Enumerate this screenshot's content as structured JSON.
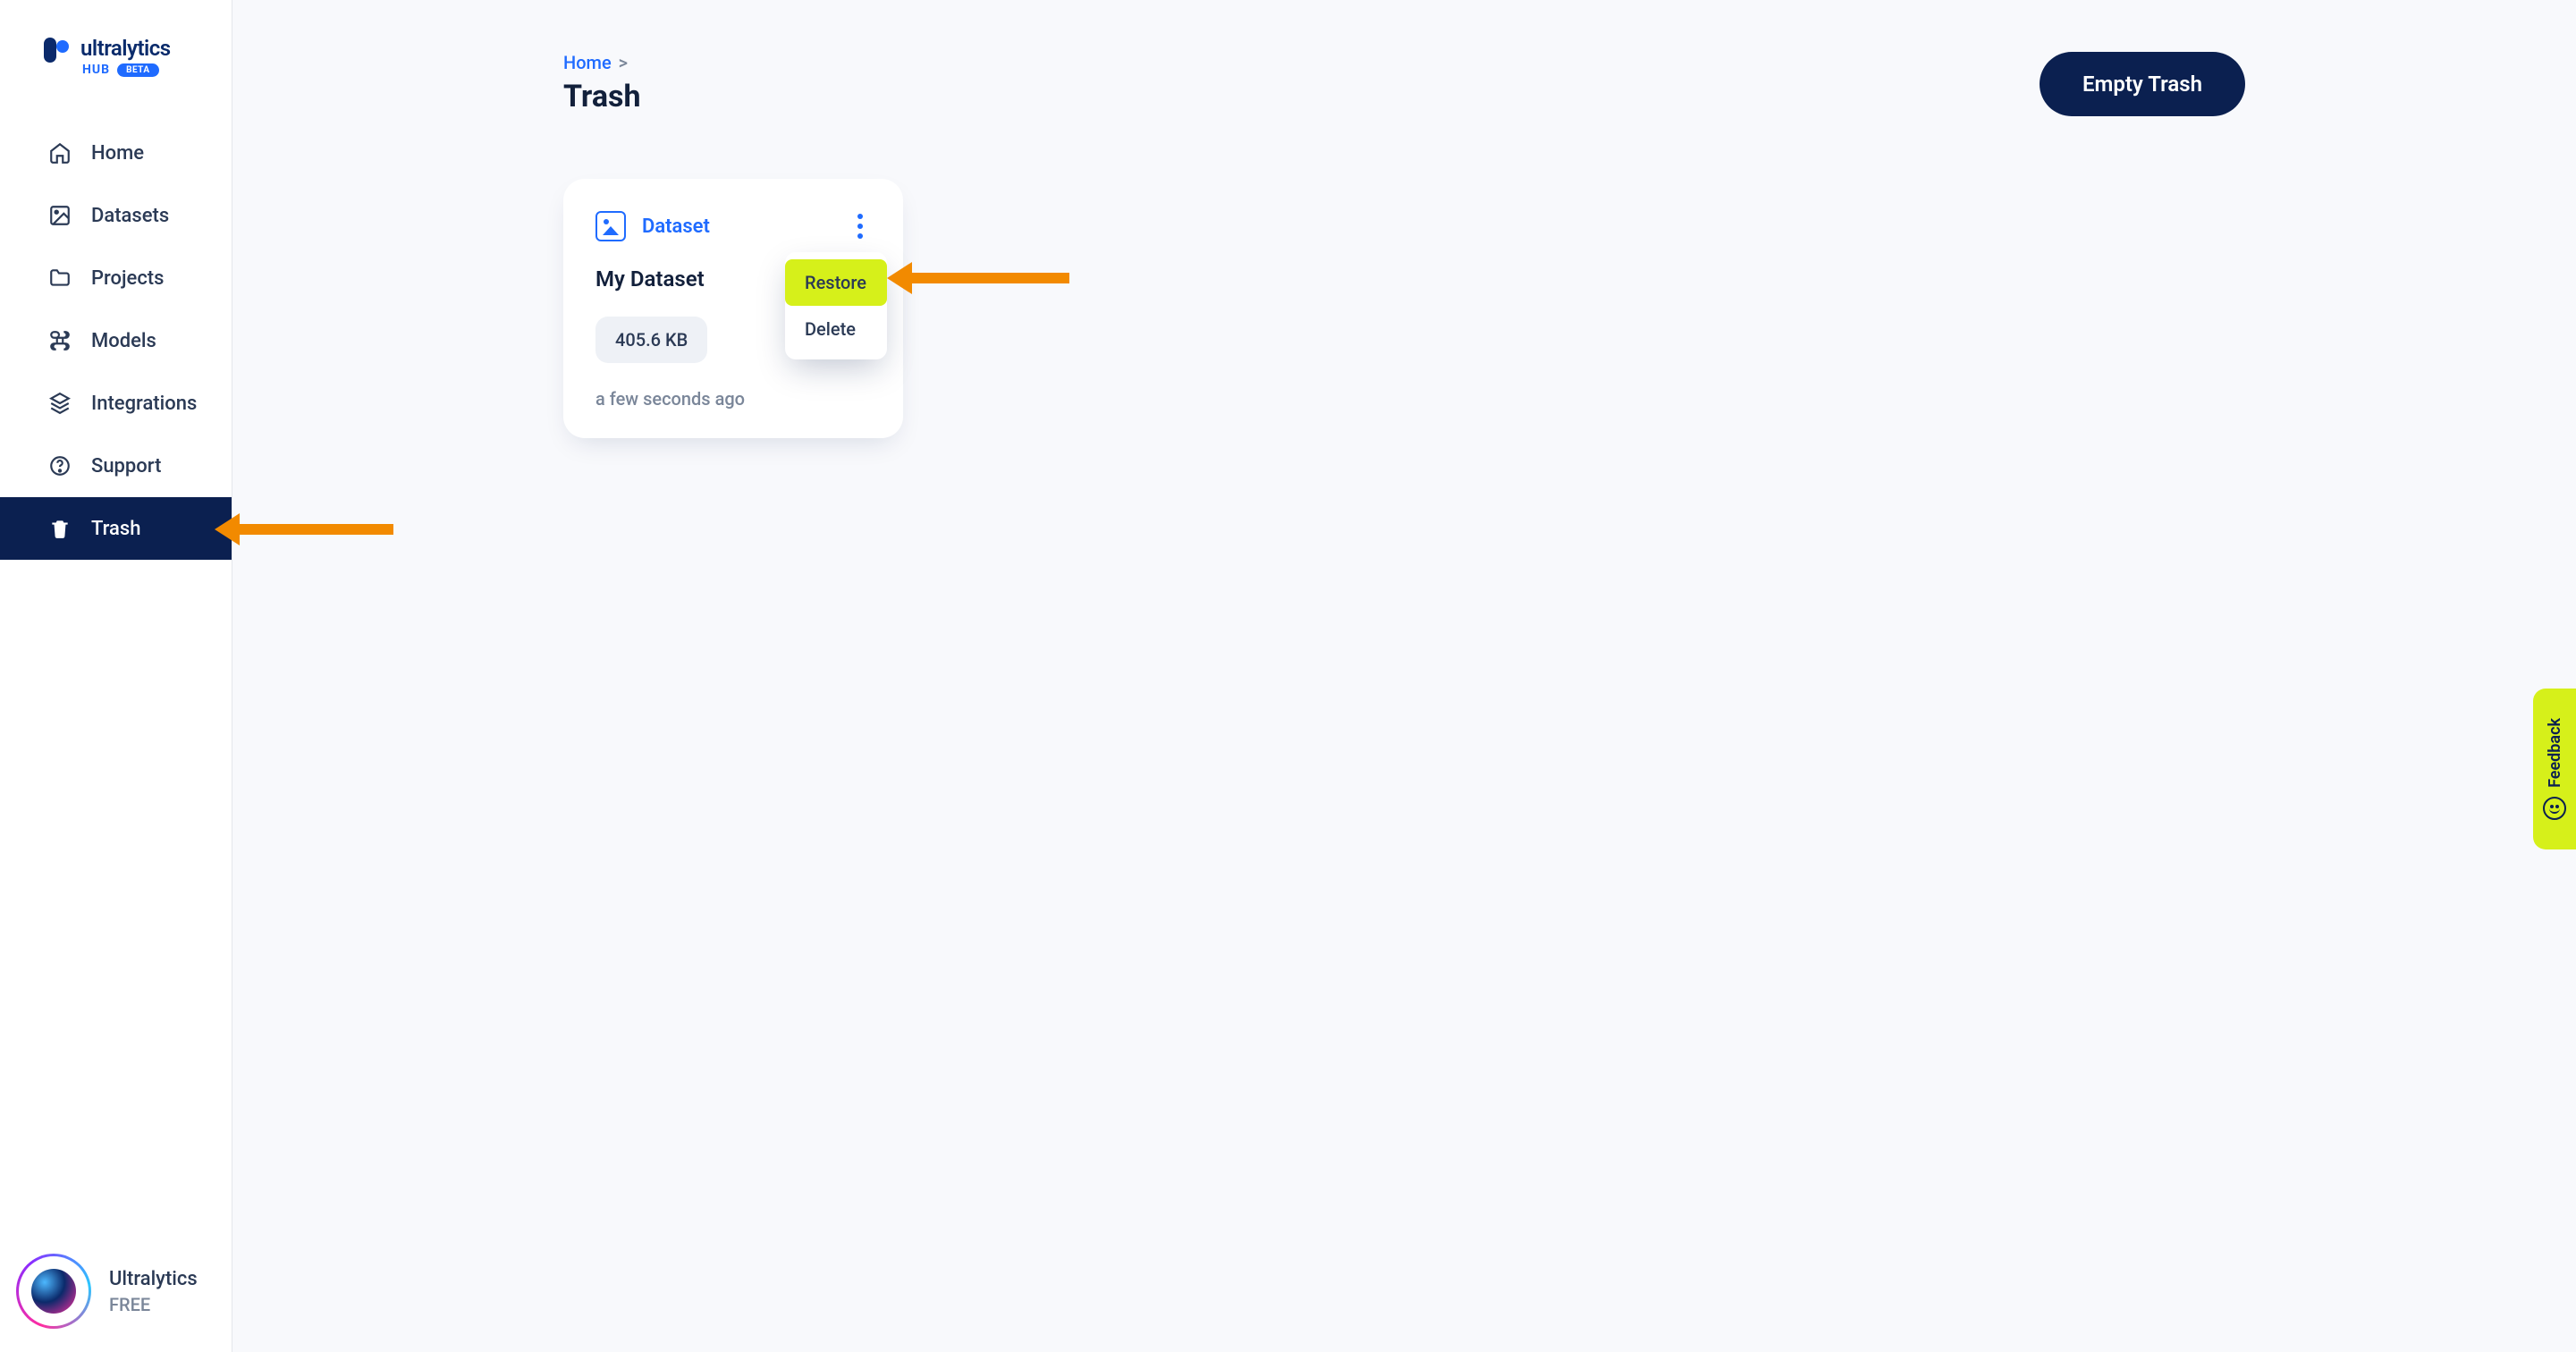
{
  "brand": {
    "name": "ultralytics",
    "sub": "HUB",
    "badge": "BETA"
  },
  "sidebar": {
    "items": [
      {
        "id": "home",
        "label": "Home"
      },
      {
        "id": "datasets",
        "label": "Datasets"
      },
      {
        "id": "projects",
        "label": "Projects"
      },
      {
        "id": "models",
        "label": "Models"
      },
      {
        "id": "integrations",
        "label": "Integrations"
      },
      {
        "id": "support",
        "label": "Support"
      },
      {
        "id": "trash",
        "label": "Trash"
      }
    ],
    "active": "trash"
  },
  "user": {
    "name": "Ultralytics",
    "plan": "FREE"
  },
  "breadcrumb": {
    "root": "Home",
    "sep": ">"
  },
  "page": {
    "title": "Trash"
  },
  "actions": {
    "empty_trash": "Empty Trash"
  },
  "card": {
    "type": "Dataset",
    "name": "My Dataset",
    "size": "405.6 KB",
    "time": "a few seconds ago"
  },
  "context_menu": {
    "restore": "Restore",
    "delete": "Delete"
  },
  "feedback": {
    "label": "Feedback"
  }
}
